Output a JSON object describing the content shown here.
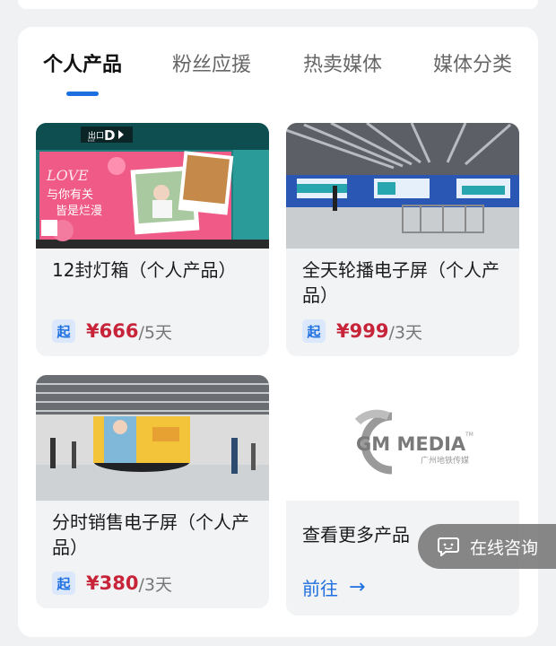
{
  "tabs": [
    {
      "label": "个人产品",
      "active": true
    },
    {
      "label": "粉丝应援",
      "active": false
    },
    {
      "label": "热卖媒体",
      "active": false
    },
    {
      "label": "媒体分类",
      "active": false
    }
  ],
  "products": [
    {
      "title": "12封灯箱（个人产品）",
      "badge": "起",
      "price": "¥666",
      "unit": "/5天",
      "image": "station-lightbox-photo"
    },
    {
      "title": "全天轮播电子屏（个人产品）",
      "badge": "起",
      "price": "¥999",
      "unit": "/3天",
      "image": "concourse-screens-photo"
    },
    {
      "title": "分时销售电子屏（个人产品）",
      "badge": "起",
      "price": "¥380",
      "unit": "/3天",
      "image": "round-screen-concourse-photo"
    }
  ],
  "more_card": {
    "logo_text": "GM MEDIA",
    "logo_tm": "TM",
    "logo_sub": "广州地铁传媒",
    "title": "查看更多产品",
    "link_label": "前往"
  },
  "photo_text": {
    "exit_sign": "出口",
    "exit_letter": "D",
    "exit_en": "Exit",
    "love": "LOVE",
    "line1": "与你有关",
    "line2": "皆是烂漫"
  },
  "float_button": {
    "label": "在线咨询",
    "icon": "chat-icon"
  },
  "colors": {
    "accent": "#1e6fe0",
    "price": "#c7243a",
    "badge_bg": "#dbe8fb"
  }
}
